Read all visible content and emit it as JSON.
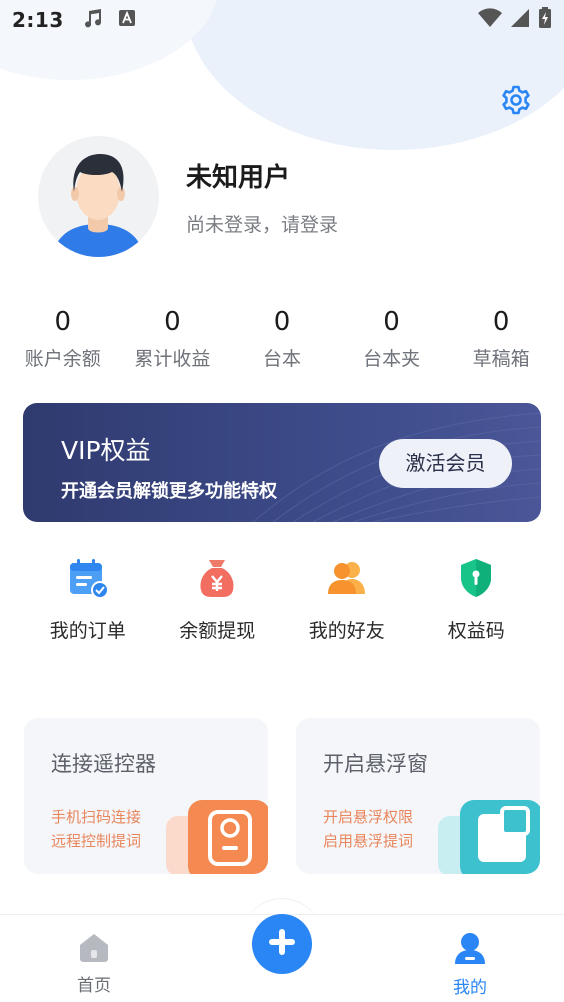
{
  "status_bar": {
    "time": "2:13",
    "icons": [
      "music-icon",
      "a-font-icon",
      "wifi-icon",
      "cell-signal-icon",
      "battery-icon"
    ]
  },
  "header": {
    "settings_icon": "gear-icon"
  },
  "profile": {
    "name": "未知用户",
    "subtitle": "尚未登录，请登录"
  },
  "stats": [
    {
      "value": "0",
      "label": "账户余额"
    },
    {
      "value": "0",
      "label": "累计收益"
    },
    {
      "value": "0",
      "label": "台本"
    },
    {
      "value": "0",
      "label": "台本夹"
    },
    {
      "value": "0",
      "label": "草稿箱"
    }
  ],
  "vip": {
    "title": "VIP权益",
    "subtitle": "开通会员解锁更多功能特权",
    "button": "激活会员"
  },
  "actions": [
    {
      "label": "我的订单",
      "icon": "calendar-check-icon"
    },
    {
      "label": "余额提现",
      "icon": "money-bag-icon"
    },
    {
      "label": "我的好友",
      "icon": "friends-icon"
    },
    {
      "label": "权益码",
      "icon": "shield-icon"
    }
  ],
  "features": [
    {
      "title": "连接遥控器",
      "line1": "手机扫码连接",
      "line2": "远程控制提词",
      "icon": "remote-icon"
    },
    {
      "title": "开启悬浮窗",
      "line1": "开启悬浮权限",
      "line2": "启用悬浮提词",
      "icon": "float-window-icon"
    }
  ],
  "nav": {
    "home": "首页",
    "mine": "我的",
    "add_icon": "plus-icon"
  },
  "colors": {
    "accent": "#2a86f5",
    "vip_bg": "#34407a",
    "feature_text": "#e8865c",
    "orange": "#f48a52",
    "teal": "#3ec1cf",
    "green_shield": "#19c489"
  }
}
